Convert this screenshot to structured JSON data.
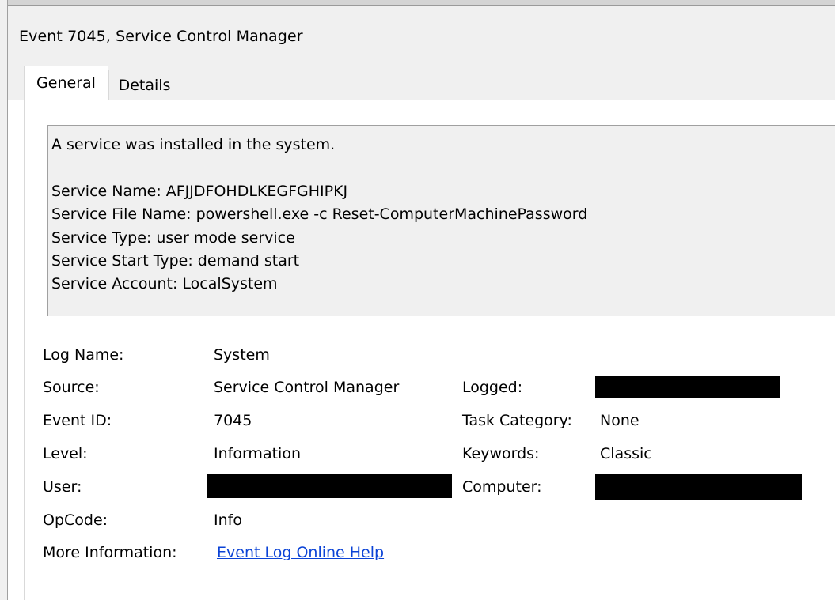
{
  "window": {
    "title": "Event 7045, Service Control Manager"
  },
  "tabs": [
    {
      "label": "General",
      "selected": true
    },
    {
      "label": "Details",
      "selected": false
    }
  ],
  "description": {
    "line1": "A service was installed in the system.",
    "service_name": "Service Name:  AFJJDFOHDLKEGFGHIPKJ",
    "service_file_name": "Service File Name:  powershell.exe -c Reset-ComputerMachinePassword",
    "service_type": "Service Type:  user mode service",
    "service_start_type": "Service Start Type:  demand start",
    "service_account": "Service Account:  LocalSystem"
  },
  "fields": {
    "log_name": {
      "label": "Log Name:",
      "value": "System"
    },
    "source": {
      "label": "Source:",
      "value": "Service Control Manager"
    },
    "logged": {
      "label": "Logged:",
      "value": ""
    },
    "event_id": {
      "label": "Event ID:",
      "value": "7045"
    },
    "task_category": {
      "label": "Task Category:",
      "value": "None"
    },
    "level": {
      "label": "Level:",
      "value": "Information"
    },
    "keywords": {
      "label": "Keywords:",
      "value": "Classic"
    },
    "user": {
      "label": "User:",
      "value": ""
    },
    "computer": {
      "label": "Computer:",
      "value": ""
    },
    "opcode": {
      "label": "OpCode:",
      "value": "Info"
    },
    "more_information": {
      "label": "More Information:",
      "link": "Event Log Online Help"
    }
  },
  "colors": {
    "link": "#0b43d6",
    "redaction": "#000000",
    "panel_bg": "#f0f0f0"
  }
}
